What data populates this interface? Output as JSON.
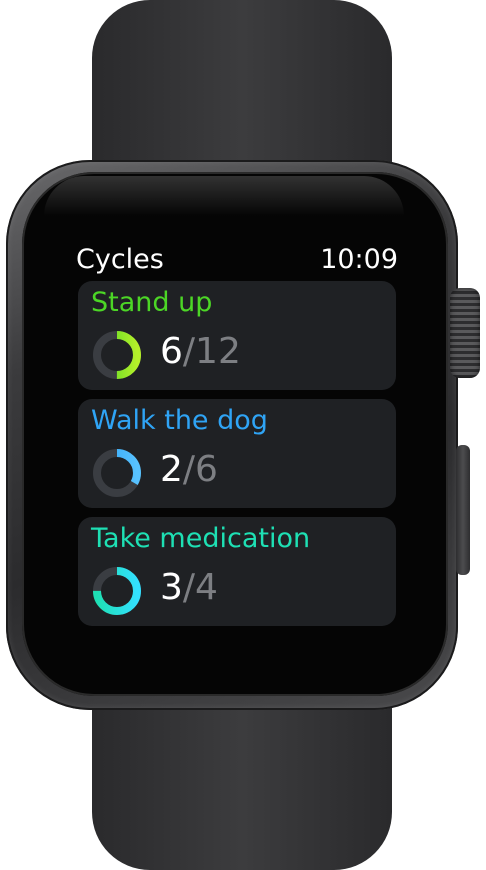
{
  "app": {
    "title": "Cycles",
    "time": "10:09"
  },
  "cycles": [
    {
      "name": "Stand up",
      "done": "6",
      "separator": "/",
      "total": "12",
      "color": "#4cd626",
      "color_end": "#b5f02a",
      "progress": 0.5
    },
    {
      "name": "Walk the dog",
      "done": "2",
      "separator": "/",
      "total": "6",
      "color": "#2fa4f5",
      "color_end": "#58c2ff",
      "progress": 0.3333
    },
    {
      "name": "Take medication",
      "done": "3",
      "separator": "/",
      "total": "4",
      "color": "#1ee0b4",
      "color_end": "#33e0ff",
      "progress": 0.75
    }
  ],
  "colors": {
    "card_bg": "#1f2124",
    "ring_track": "#3a3d42",
    "muted_text": "#7d7f83"
  },
  "icons": {
    "progress_ring": "progress-ring-icon",
    "digital_crown": "digital-crown",
    "side_button": "side-button"
  }
}
